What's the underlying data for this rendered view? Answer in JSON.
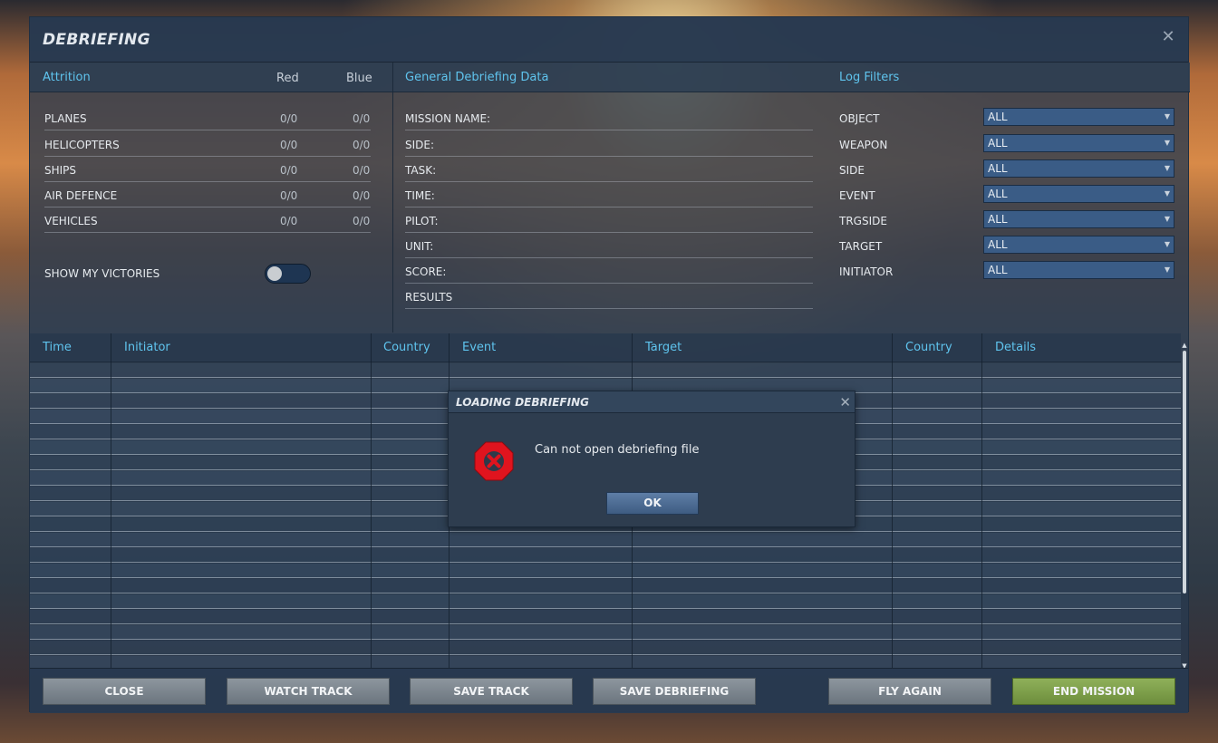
{
  "window": {
    "title": "DEBRIEFING"
  },
  "attrition": {
    "header": "Attrition",
    "col_red": "Red",
    "col_blue": "Blue",
    "rows": [
      {
        "label": "PLANES",
        "red": "0/0",
        "blue": "0/0"
      },
      {
        "label": "HELICOPTERS",
        "red": "0/0",
        "blue": "0/0"
      },
      {
        "label": "SHIPS",
        "red": "0/0",
        "blue": "0/0"
      },
      {
        "label": "AIR DEFENCE",
        "red": "0/0",
        "blue": "0/0"
      },
      {
        "label": "VEHICLES",
        "red": "0/0",
        "blue": "0/0"
      }
    ],
    "show_victories_label": "SHOW MY VICTORIES",
    "show_victories_on": false
  },
  "general": {
    "header": "General Debriefing Data",
    "fields": [
      "MISSION NAME:",
      "SIDE:",
      "TASK:",
      "TIME:",
      "PILOT:",
      "UNIT:",
      "SCORE:",
      "RESULTS"
    ]
  },
  "filters": {
    "header": "Log Filters",
    "items": [
      {
        "label": "OBJECT",
        "value": "ALL"
      },
      {
        "label": "WEAPON",
        "value": "ALL"
      },
      {
        "label": "SIDE",
        "value": "ALL"
      },
      {
        "label": "EVENT",
        "value": "ALL"
      },
      {
        "label": "TRGSIDE",
        "value": "ALL"
      },
      {
        "label": "TARGET",
        "value": "ALL"
      },
      {
        "label": "INITIATOR",
        "value": "ALL"
      }
    ]
  },
  "log": {
    "columns": [
      "Time",
      "Initiator",
      "Country",
      "Event",
      "Target",
      "Country",
      "Details"
    ]
  },
  "footer": {
    "close": "CLOSE",
    "watch_track": "WATCH TRACK",
    "save_track": "SAVE TRACK",
    "save_debriefing": "SAVE DEBRIEFING",
    "fly_again": "FLY AGAIN",
    "end_mission": "END MISSION"
  },
  "dialog": {
    "title": "LOADING DEBRIEFING",
    "message": "Can not open debriefing file",
    "ok": "OK"
  },
  "colors": {
    "accent": "#5fc4ee",
    "end_mission_green": "#7a9c48",
    "error_red": "#e0141e"
  }
}
